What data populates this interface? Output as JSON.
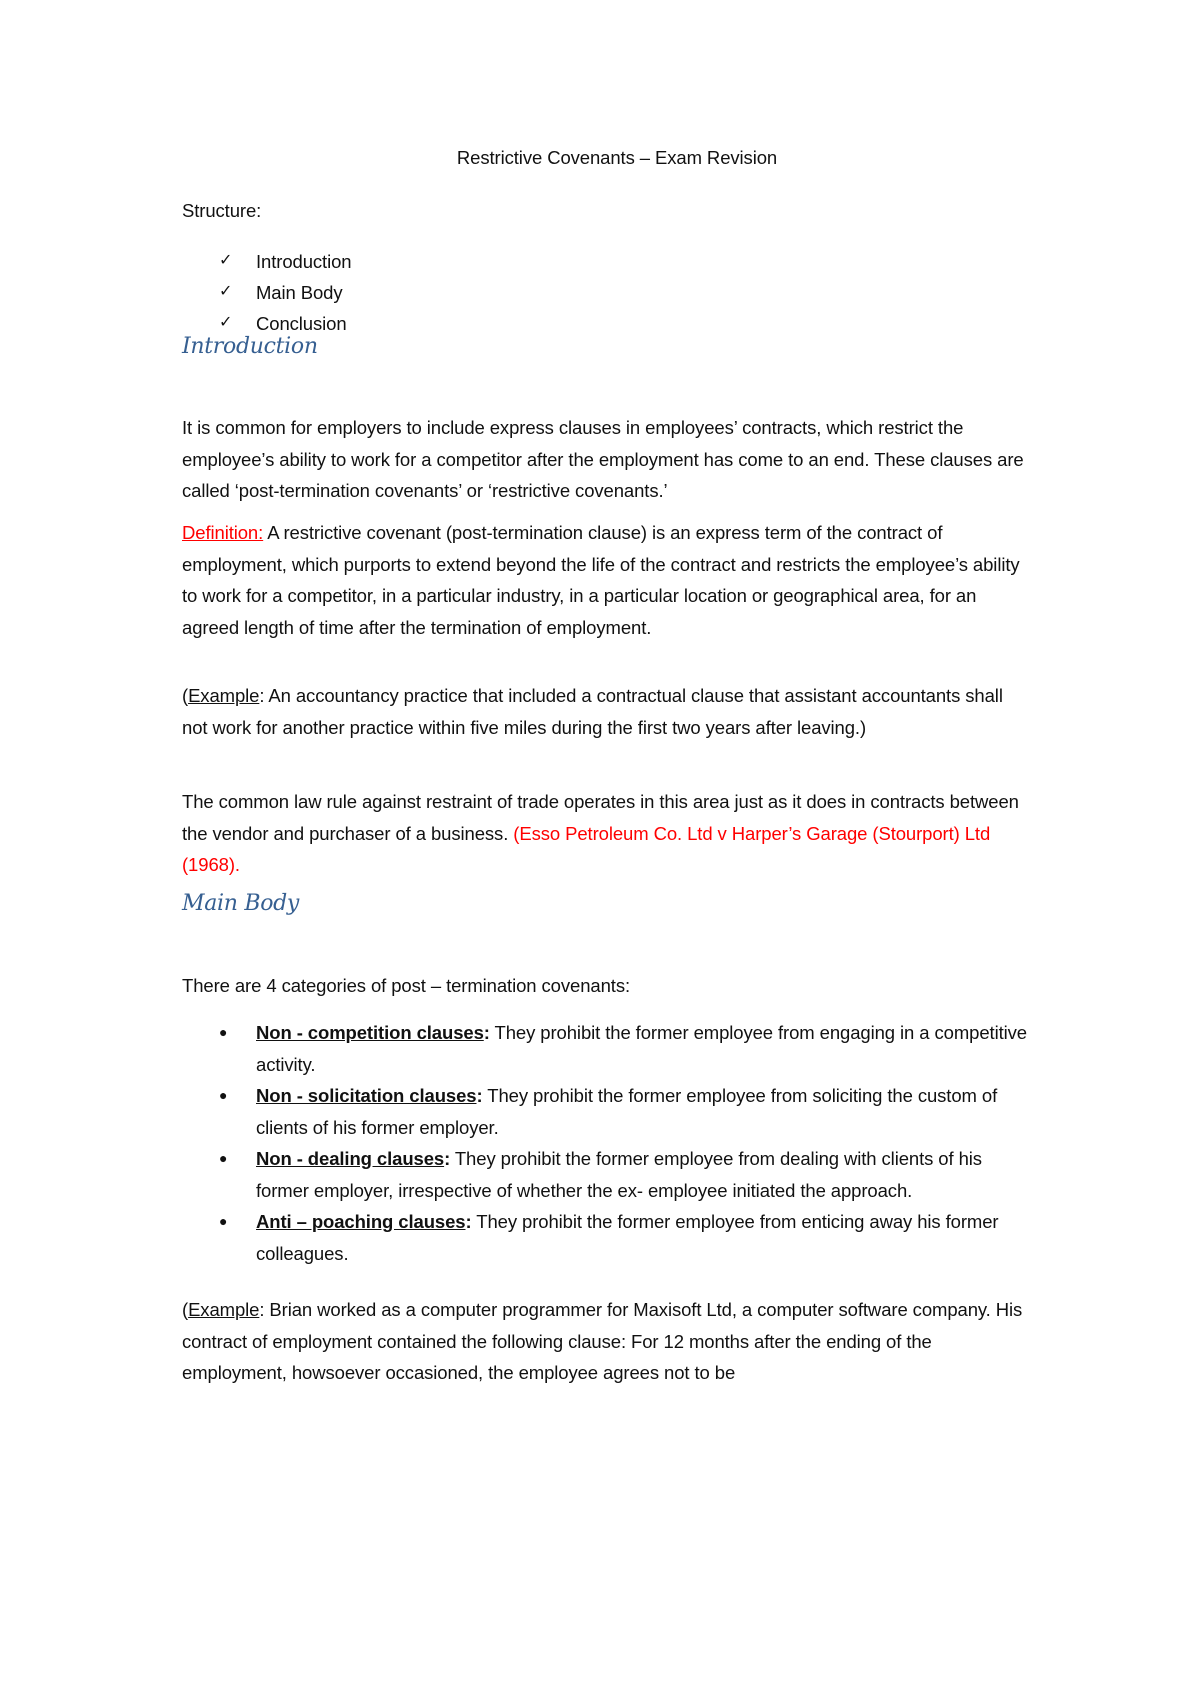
{
  "document": {
    "title": "Restrictive Covenants – Exam Revision",
    "structure": {
      "label": "Structure:",
      "items": [
        {
          "icon": "check-icon",
          "label": "Introduction"
        },
        {
          "icon": "check-icon",
          "label": "Main Body"
        },
        {
          "icon": "check-icon",
          "label": "Conclusion"
        }
      ]
    },
    "introduction": {
      "heading": "Introduction",
      "para1": "It is common for employers to include express clauses in employees’ contracts, which restrict the employee’s ability to work for a competitor after the employment has come to an end. These clauses are called ‘post-termination covenants’ or ‘restrictive covenants.’",
      "definition": {
        "label": "Definition:",
        "text": " A restrictive covenant (post-termination clause) is an express term of the contract of employment, which purports to extend beyond the life of the contract and restricts the employee’s ability to work for a competitor, in a particular industry, in a particular location or geographical area, for an agreed length of time after the termination of employment."
      },
      "example": {
        "open": "(",
        "label": "Example",
        "text": ": An accountancy practice that included a contractual clause that assistant accountants shall not work for another practice within five miles during the first two years after leaving.)"
      },
      "para3": {
        "text": "The common law rule against restraint of trade operates in this area just as it does in contracts between the vendor and purchaser of a business. ",
        "case": "(Esso Petroleum Co. Ltd v Harper’s Garage (Stourport) Ltd (1968)."
      }
    },
    "main_body": {
      "heading": "Main Body",
      "intro": "There are 4 categories of post – termination covenants:",
      "categories": [
        {
          "term": "Non - competition clauses",
          "colon": ":",
          "text": " They prohibit the former employee from engaging in a competitive activity."
        },
        {
          "term": "Non - solicitation clauses",
          "colon": ":",
          "text": " They prohibit the former employee from soliciting the custom of clients of his former employer."
        },
        {
          "term": "Non - dealing clauses",
          "colon": ":",
          "text": " They prohibit the former employee from dealing with clients of his former employer, irrespective of whether the ex- employee initiated the approach."
        },
        {
          "term": "Anti – poaching clauses",
          "colon": ":",
          "text": " They prohibit the former employee from enticing away his former colleagues."
        }
      ],
      "example": {
        "open": "(",
        "label": "Example",
        "text": ": Brian worked as a computer programmer for Maxisoft Ltd, a computer software company. His contract of employment contained the following clause: For 12 months after the ending of the employment, howsoever occasioned, the employee agrees not to be"
      }
    },
    "colors": {
      "heading": "#365f91",
      "emphasis_red": "#ff0000",
      "text": "#111111"
    }
  }
}
